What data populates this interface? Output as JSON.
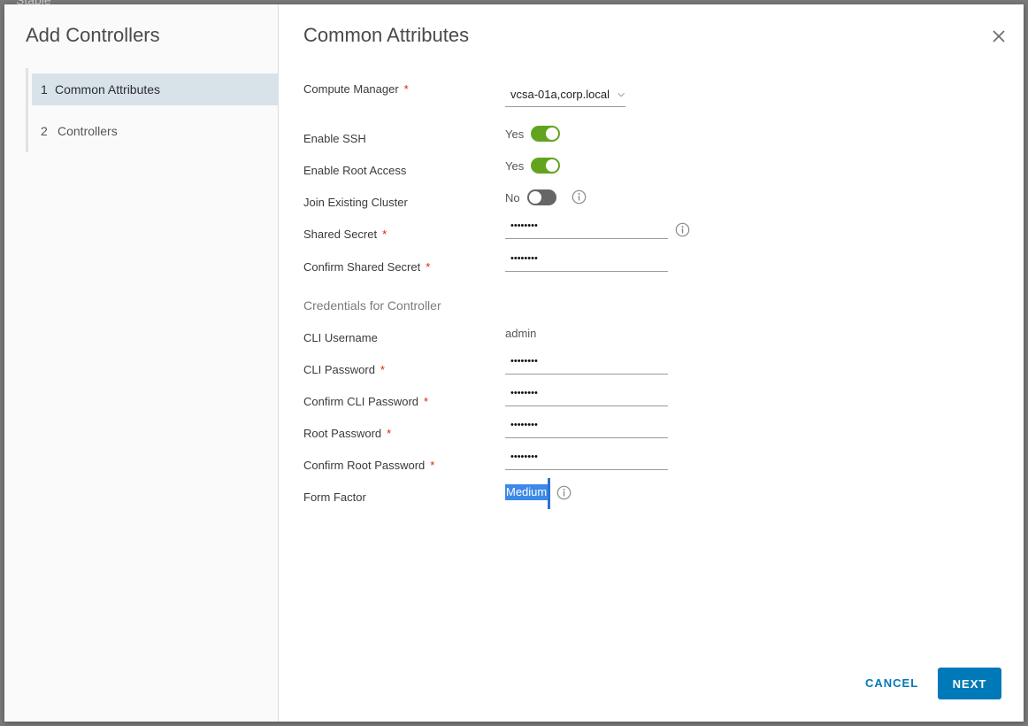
{
  "backdrop": {
    "text": "Stable"
  },
  "wizard": {
    "title": "Add Controllers",
    "steps": [
      {
        "num": "1",
        "label": "Common Attributes",
        "active": true
      },
      {
        "num": "2",
        "label": "Controllers",
        "active": false
      }
    ]
  },
  "form": {
    "title": "Common Attributes",
    "compute_manager": {
      "label": "Compute Manager",
      "required": "*",
      "value": "vcsa-01a,corp.local"
    },
    "enable_ssh": {
      "label": "Enable SSH",
      "state_text": "Yes"
    },
    "enable_root": {
      "label": "Enable Root Access",
      "state_text": "Yes"
    },
    "join_cluster": {
      "label": "Join Existing Cluster",
      "state_text": "No"
    },
    "shared_secret": {
      "label": "Shared Secret",
      "required": "*",
      "value": "••••••••"
    },
    "confirm_shared_secret": {
      "label": "Confirm Shared Secret",
      "required": "*",
      "value": "••••••••"
    },
    "credentials_section": "Credentials for Controller",
    "cli_username": {
      "label": "CLI Username",
      "value": "admin"
    },
    "cli_password": {
      "label": "CLI Password",
      "required": "*",
      "value": "••••••••"
    },
    "confirm_cli_password": {
      "label": "Confirm CLI Password",
      "required": "*",
      "value": "••••••••"
    },
    "root_password": {
      "label": "Root Password",
      "required": "*",
      "value": "••••••••"
    },
    "confirm_root_password": {
      "label": "Confirm Root Password",
      "required": "*",
      "value": "••••••••"
    },
    "form_factor": {
      "label": "Form Factor",
      "value": "Medium"
    }
  },
  "footer": {
    "cancel_label": "CANCEL",
    "next_label": "NEXT"
  },
  "colors": {
    "accent": "#0079b8",
    "toggle_on": "#62a420",
    "toggle_off": "#666666",
    "required": "#e12200",
    "selection": "#3d89e8"
  }
}
